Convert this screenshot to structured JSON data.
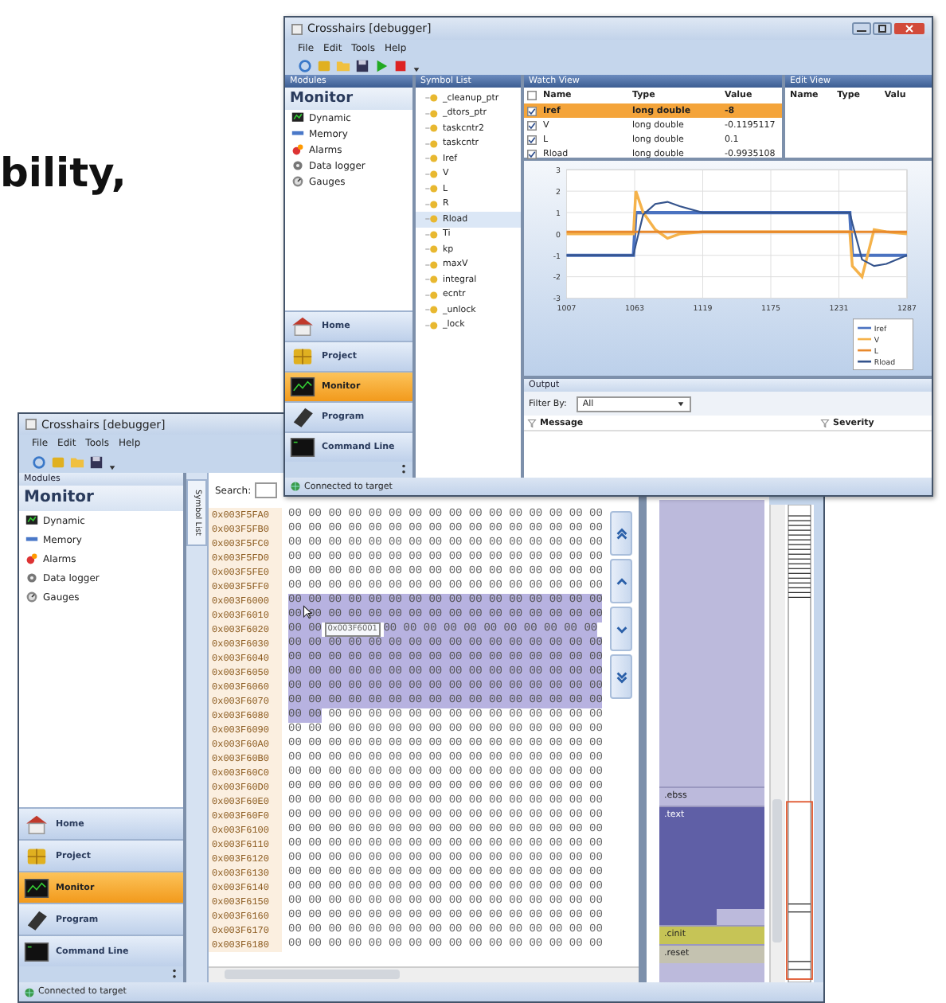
{
  "tagline": "bility,",
  "front_window": {
    "title": "Crosshairs [debugger]",
    "menu": [
      "File",
      "Edit",
      "Tools",
      "Help"
    ],
    "modules": {
      "header": "Modules",
      "title": "Monitor",
      "items": [
        "Dynamic",
        "Memory",
        "Alarms",
        "Data logger",
        "Gauges"
      ],
      "nav": [
        {
          "label": "Home",
          "selected": false
        },
        {
          "label": "Project",
          "selected": false
        },
        {
          "label": "Monitor",
          "selected": true
        },
        {
          "label": "Program",
          "selected": false
        },
        {
          "label": "Command Line",
          "selected": false
        }
      ]
    },
    "symbol_list": {
      "header": "Symbol List",
      "items": [
        {
          "label": "_cleanup_ptr",
          "selected": false
        },
        {
          "label": "_dtors_ptr",
          "selected": false
        },
        {
          "label": "taskcntr2",
          "selected": false
        },
        {
          "label": "taskcntr",
          "selected": false
        },
        {
          "label": "Iref",
          "selected": false
        },
        {
          "label": "V",
          "selected": false
        },
        {
          "label": "L",
          "selected": false
        },
        {
          "label": "R",
          "selected": false
        },
        {
          "label": "Rload",
          "selected": true
        },
        {
          "label": "Ti",
          "selected": false
        },
        {
          "label": "kp",
          "selected": false
        },
        {
          "label": "maxV",
          "selected": false
        },
        {
          "label": "integral",
          "selected": false
        },
        {
          "label": "ecntr",
          "selected": false
        },
        {
          "label": "_unlock",
          "selected": false
        },
        {
          "label": "_lock",
          "selected": false
        }
      ]
    },
    "watch_view": {
      "header": "Watch View",
      "columns": [
        "Name",
        "Type",
        "Value"
      ],
      "rows": [
        {
          "name": "Iref",
          "type": "long double",
          "value": "-8",
          "checked": true,
          "selected": true
        },
        {
          "name": "V",
          "type": "long double",
          "value": "-0.1195117",
          "checked": true,
          "selected": false
        },
        {
          "name": "L",
          "type": "long double",
          "value": "0.1",
          "checked": true,
          "selected": false
        },
        {
          "name": "Rload",
          "type": "long double",
          "value": "-0.9935108",
          "checked": true,
          "selected": false
        }
      ]
    },
    "edit_view": {
      "header": "Edit View",
      "columns": [
        "Name",
        "Type",
        "Valu"
      ]
    },
    "chart_data": {
      "type": "line",
      "grid": true,
      "legend": "bottom-right",
      "x": [
        1007,
        1040,
        1062,
        1064,
        1070,
        1080,
        1090,
        1100,
        1119,
        1150,
        1175,
        1200,
        1230,
        1240,
        1242,
        1250,
        1260,
        1270,
        1287
      ],
      "xlim": [
        1007,
        1287
      ],
      "ylim": [
        -3,
        3
      ],
      "xticks": [
        1007,
        1063,
        1119,
        1175,
        1231,
        1287
      ],
      "yticks": [
        -3,
        -2,
        -1,
        0,
        1,
        2,
        3
      ],
      "series": [
        {
          "name": "Iref",
          "color": "#4a72c0",
          "values": [
            -1,
            -1,
            -1,
            1,
            1,
            1,
            1,
            1,
            1,
            1,
            1,
            1,
            1,
            1,
            -1,
            -1,
            -1,
            -1,
            -1
          ]
        },
        {
          "name": "V",
          "color": "#f5b24a",
          "values": [
            0,
            0,
            0,
            2,
            1,
            0.2,
            -0.2,
            0,
            0.1,
            0.1,
            0.1,
            0.1,
            0.1,
            0.1,
            -1.5,
            -2,
            0.2,
            0.1,
            0
          ]
        },
        {
          "name": "L",
          "color": "#e8892c",
          "values": [
            0.1,
            0.1,
            0.1,
            0.1,
            0.1,
            0.1,
            0.1,
            0.1,
            0.1,
            0.1,
            0.1,
            0.1,
            0.1,
            0.1,
            0.1,
            0.1,
            0.1,
            0.1,
            0.1
          ]
        },
        {
          "name": "Rload",
          "color": "#34538c",
          "values": [
            -1,
            -1,
            -1,
            -0.5,
            0.9,
            1.4,
            1.5,
            1.3,
            1,
            1,
            1,
            1,
            1,
            1,
            0.5,
            -1.2,
            -1.5,
            -1.4,
            -1
          ]
        }
      ]
    },
    "output": {
      "header": "Output",
      "filter_label": "Filter By:",
      "filter_value": "All",
      "columns": [
        "Message",
        "Severity"
      ]
    },
    "status": "Connected to target"
  },
  "back_window": {
    "title": "Crosshairs [debugger]",
    "menu": [
      "File",
      "Edit",
      "Tools",
      "Help"
    ],
    "modules": {
      "header": "Modules",
      "title": "Monitor",
      "items": [
        "Dynamic",
        "Memory",
        "Alarms",
        "Data logger",
        "Gauges"
      ],
      "nav": [
        {
          "label": "Home",
          "selected": false
        },
        {
          "label": "Project",
          "selected": false
        },
        {
          "label": "Monitor",
          "selected": true
        },
        {
          "label": "Program",
          "selected": false
        },
        {
          "label": "Command Line",
          "selected": false
        }
      ]
    },
    "symbol_tab": "Symbol List",
    "search_label": "Search:",
    "hex_rows": [
      {
        "address": "0x003F5FA0",
        "groups": [
          {
            "text": "00 00 00 00 00 00 00 00 00 00 00 00 00 00 00 00",
            "selected": false
          }
        ]
      },
      {
        "address": "0x003F5FB0",
        "groups": [
          {
            "text": "00 00 00 00 00 00 00 00 00 00 00 00 00 00 00 00",
            "selected": false
          }
        ]
      },
      {
        "address": "0x003F5FC0",
        "groups": [
          {
            "text": "00 00 00 00 00 00 00 00 00 00 00 00 00 00 00 00",
            "selected": false
          }
        ]
      },
      {
        "address": "0x003F5FD0",
        "groups": [
          {
            "text": "00 00 00 00 00 00 00 00 00 00 00 00 00 00 00 00",
            "selected": false
          }
        ]
      },
      {
        "address": "0x003F5FE0",
        "groups": [
          {
            "text": "00 00 00 00 00 00 00 00 00 00 00 00 00 00 00 00",
            "selected": false
          }
        ]
      },
      {
        "address": "0x003F5FF0",
        "groups": [
          {
            "text": "00 00 00 00 00 00 00 00 00 00 00 00 00 00 00 00",
            "selected": false
          }
        ]
      },
      {
        "address": "0x003F6000",
        "groups": [
          {
            "text": "00 00 00 00 00 00 00 00 00 00 00 00 00 00 00 00",
            "selected": true
          }
        ]
      },
      {
        "address": "0x003F6010",
        "groups": [
          {
            "text": "00 00 00 00 00 00 00 00 00 00 00 00 00 00 00 00",
            "selected": true
          }
        ]
      },
      {
        "address": "0x003F6020",
        "tooltip": "0x003F6001",
        "groups": [
          {
            "text": "00 00",
            "selected": true
          },
          {
            "text": "00 00 00 00 00 00 00 00 00 00 00",
            "selected": true
          }
        ]
      },
      {
        "address": "0x003F6030",
        "groups": [
          {
            "text": "00 00 00 00 00 00 00 00 00 00 00 00 00 00 00 00",
            "selected": true
          }
        ]
      },
      {
        "address": "0x003F6040",
        "groups": [
          {
            "text": "00 00 00 00 00 00 00 00 00 00 00 00 00 00 00 00",
            "selected": true
          }
        ]
      },
      {
        "address": "0x003F6050",
        "groups": [
          {
            "text": "00 00 00 00 00 00 00 00 00 00 00 00 00 00 00 00",
            "selected": true
          }
        ]
      },
      {
        "address": "0x003F6060",
        "groups": [
          {
            "text": "00 00 00 00 00 00 00 00 00 00 00 00 00 00 00 00",
            "selected": true
          }
        ]
      },
      {
        "address": "0x003F6070",
        "groups": [
          {
            "text": "00 00 00 00 00 00 00 00 00 00 00 00 00 00 00 00",
            "selected": true
          }
        ]
      },
      {
        "address": "0x003F6080",
        "groups": [
          {
            "text": "00 00",
            "selected": true
          },
          {
            "text": "00 00 00 00 00 00 00 00 00 00 00 00 00 00",
            "selected": false
          }
        ]
      },
      {
        "address": "0x003F6090",
        "groups": [
          {
            "text": "00 00 00 00 00 00 00 00 00 00 00 00 00 00 00 00",
            "selected": false
          }
        ]
      },
      {
        "address": "0x003F60A0",
        "groups": [
          {
            "text": "00 00 00 00 00 00 00 00 00 00 00 00 00 00 00 00",
            "selected": false
          }
        ]
      },
      {
        "address": "0x003F60B0",
        "groups": [
          {
            "text": "00 00 00 00 00 00 00 00 00 00 00 00 00 00 00 00",
            "selected": false
          }
        ]
      },
      {
        "address": "0x003F60C0",
        "groups": [
          {
            "text": "00 00 00 00 00 00 00 00 00 00 00 00 00 00 00 00",
            "selected": false
          }
        ]
      },
      {
        "address": "0x003F60D0",
        "groups": [
          {
            "text": "00 00 00 00 00 00 00 00 00 00 00 00 00 00 00 00",
            "selected": false
          }
        ]
      },
      {
        "address": "0x003F60E0",
        "groups": [
          {
            "text": "00 00 00 00 00 00 00 00 00 00 00 00 00 00 00 00",
            "selected": false
          }
        ]
      },
      {
        "address": "0x003F60F0",
        "groups": [
          {
            "text": "00 00 00 00 00 00 00 00 00 00 00 00 00 00 00 00",
            "selected": false
          }
        ]
      },
      {
        "address": "0x003F6100",
        "groups": [
          {
            "text": "00 00 00 00 00 00 00 00 00 00 00 00 00 00 00 00",
            "selected": false
          }
        ]
      },
      {
        "address": "0x003F6110",
        "groups": [
          {
            "text": "00 00 00 00 00 00 00 00 00 00 00 00 00 00 00 00",
            "selected": false
          }
        ]
      },
      {
        "address": "0x003F6120",
        "groups": [
          {
            "text": "00 00 00 00 00 00 00 00 00 00 00 00 00 00 00 00",
            "selected": false
          }
        ]
      },
      {
        "address": "0x003F6130",
        "groups": [
          {
            "text": "00 00 00 00 00 00 00 00 00 00 00 00 00 00 00 00",
            "selected": false
          }
        ]
      },
      {
        "address": "0x003F6140",
        "groups": [
          {
            "text": "00 00 00 00 00 00 00 00 00 00 00 00 00 00 00 00",
            "selected": false
          }
        ]
      },
      {
        "address": "0x003F6150",
        "groups": [
          {
            "text": "00 00 00 00 00 00 00 00 00 00 00 00 00 00 00 00",
            "selected": false
          }
        ]
      },
      {
        "address": "0x003F6160",
        "groups": [
          {
            "text": "00 00 00 00 00 00 00 00 00 00 00 00 00 00 00 00",
            "selected": false
          }
        ]
      },
      {
        "address": "0x003F6170",
        "groups": [
          {
            "text": "00 00 00 00 00 00 00 00 00 00 00 00 00 00 00 00",
            "selected": false
          }
        ]
      },
      {
        "address": "0x003F6180",
        "groups": [
          {
            "text": "00 00 00 00 00 00 00 00 00 00 00 00 00 00 00 00",
            "selected": false
          }
        ]
      }
    ],
    "segments": [
      {
        "label": ".ebss",
        "color": "#bcbadc",
        "kind": "strip"
      },
      {
        "label": ".text",
        "color": "#5f5fa6",
        "kind": "block"
      },
      {
        "label": ".cinit",
        "color": "#c6c456",
        "kind": "strip"
      },
      {
        "label": ".reset",
        "color": "#c4c2b0",
        "kind": "strip"
      }
    ],
    "status": "Connected to target"
  }
}
